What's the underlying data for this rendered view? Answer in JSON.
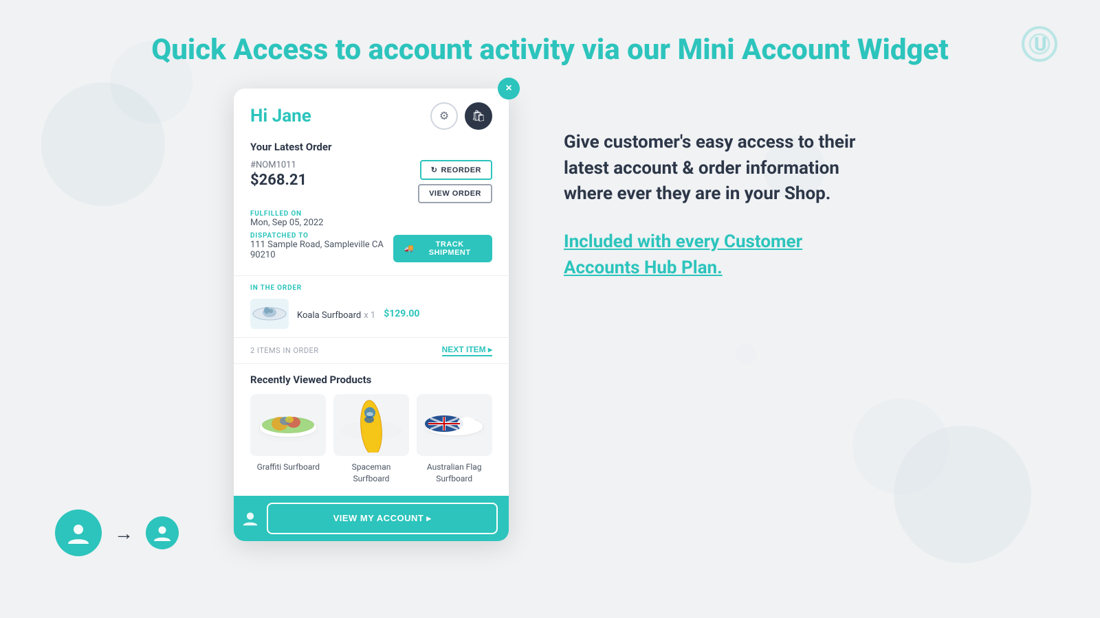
{
  "page": {
    "title_part1": "Quick Access to account activity via our ",
    "title_highlight": "Mini Account Widget"
  },
  "logo": {
    "icon": "⟨⟩"
  },
  "widget": {
    "greeting": "Hi Jane",
    "close_label": "×",
    "order": {
      "section_title": "Your Latest Order",
      "order_number": "#NOM1011",
      "total": "$268.21",
      "fulfilled_label": "FULFILLED ON",
      "fulfilled_date": "Mon, Sep 05, 2022",
      "dispatched_label": "DISPATCHED TO",
      "dispatched_address": "111 Sample Road, Sampleville CA 90210",
      "reorder_label": "REORDER",
      "view_order_label": "VIEW ORDER",
      "track_label": "TRACK SHIPMENT"
    },
    "in_order": {
      "label": "IN THE ORDER",
      "item_name": "Koala Surfboard",
      "item_qty": "x 1",
      "item_price": "$129.00",
      "items_count": "2 ITEMS IN ORDER",
      "next_item_label": "NEXT ITEM ▸"
    },
    "recently_viewed": {
      "title": "Recently Viewed Products",
      "products": [
        {
          "name": "Graffiti Surfboard"
        },
        {
          "name": "Spaceman Surfboard"
        },
        {
          "name": "Australian Flag Surfboard"
        }
      ]
    },
    "footer": {
      "view_account_label": "VIEW MY ACCOUNT ▸"
    }
  },
  "right": {
    "description": "Give customer's easy access to their latest account & order information where ever they are in your Shop.",
    "cta_part1": "Included with ",
    "cta_every": "every",
    "cta_part2": " Customer Accounts Hub Plan."
  }
}
